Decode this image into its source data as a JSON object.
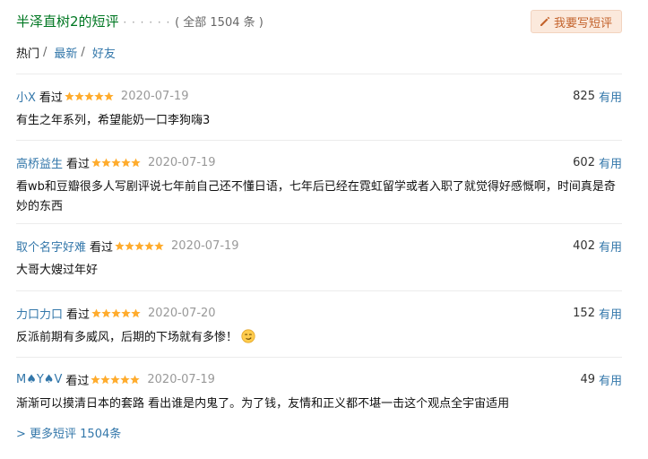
{
  "header": {
    "title": "半泽直树2的短评",
    "dots": "· · · · · ·",
    "count_text": "( 全部 1504 条 )",
    "write_button": "我要写短评"
  },
  "tabs": [
    {
      "label": "热门",
      "sep": "/"
    },
    {
      "label": "最新",
      "sep": "/"
    },
    {
      "label": "好友",
      "sep": ""
    }
  ],
  "comments": [
    {
      "user": "小X",
      "status": "看过",
      "rating": 5,
      "date": "2020-07-19",
      "votes": "825",
      "vote_label": "有用",
      "text": "有生之年系列，希望能奶一口李狗嗨3"
    },
    {
      "user": "高桥益生",
      "status": "看过",
      "rating": 5,
      "date": "2020-07-19",
      "votes": "602",
      "vote_label": "有用",
      "text": "看wb和豆瓣很多人写剧评说七年前自己还不懂日语，七年后已经在霓虹留学或者入职了就觉得好感慨啊，时间真是奇妙的东西"
    },
    {
      "user": "取个名字好难",
      "status": "看过",
      "rating": 5,
      "date": "2020-07-19",
      "votes": "402",
      "vote_label": "有用",
      "text": "大哥大嫂过年好"
    },
    {
      "user": "力口力口",
      "status": "看过",
      "rating": 5,
      "date": "2020-07-20",
      "votes": "152",
      "vote_label": "有用",
      "text": "反派前期有多威风，后期的下场就有多惨！"
    },
    {
      "user": "M♠Y♠V",
      "status": "看过",
      "rating": 5,
      "date": "2020-07-19",
      "votes": "49",
      "vote_label": "有用",
      "text": "渐渐可以摸清日本的套路 看出谁是内鬼了。为了钱，友情和正义都不堪一击这个观点全宇宙适用"
    }
  ],
  "more_link": "> 更多短评 1504条",
  "colors": {
    "link": "#3377aa",
    "title_green": "#007722",
    "star": "#ffac2d",
    "button_bg": "#fbe9dc",
    "button_text": "#c3622b"
  },
  "icons": {
    "write": "pencil-icon",
    "rating": "star-icon",
    "emoji": "smirk-emoji-icon"
  }
}
